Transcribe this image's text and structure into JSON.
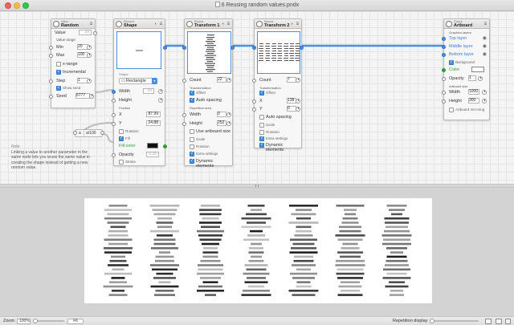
{
  "window": {
    "title": "6 Reusing random values.pndx"
  },
  "colors": {
    "accent": "#4a90e2",
    "wire": "#4a90e2",
    "fill_color": "#111111"
  },
  "random_node": {
    "category": "Value",
    "name": "Random",
    "value_label": "Value",
    "value": "20",
    "range_label": "Value range",
    "min_label": "Min",
    "min": "20",
    "max_label": "Max",
    "max": "100",
    "xrange_label": "x-range",
    "incremental_label": "Incremental",
    "step_label": "Step",
    "step": "1",
    "show_seed_label": "Show seed",
    "seed_label": "Seed",
    "seed": "6777"
  },
  "shape_node": {
    "category": "Element",
    "name": "Shape",
    "shape_section": "Shape",
    "shape_value": "Rectangle",
    "width_label": "Width",
    "width": "20",
    "height_label": "Height",
    "position_label": "Position",
    "x_label": "X",
    "x": "87.99",
    "y_label": "Y",
    "y": "24.88",
    "rotation_label": "Rotation",
    "fill_label": "Fill",
    "fill_color_label": "Fill color",
    "opacity_label": "Opacity",
    "opacity": "0.35",
    "stroke_label": "Stroke"
  },
  "expr_node": {
    "label": "a",
    "value": "a/100"
  },
  "transform1": {
    "category": "Repeat",
    "name": "Transform 1",
    "count_label": "Count",
    "count": "22",
    "transformation_label": "Transformation",
    "offset_label": "Offset",
    "auto_spacing_label": "Auto spacing",
    "repetition_area_label": "Repetition area",
    "width_label": "Width",
    "width": "0",
    "height_label": "Height",
    "height": "252",
    "use_artboard_label": "Use artboard size",
    "scale_label": "Scale",
    "rotation_label": "Rotation",
    "extra_settings_label": "Extra settings",
    "dynamic_label": "Dynamic elements"
  },
  "transform2": {
    "category": "Repeat",
    "name": "Transform 2",
    "count_label": "Count",
    "count": "7",
    "transformation_label": "Transformation",
    "offset_label": "Offset",
    "x_label": "X",
    "x": "138",
    "y_label": "Y",
    "y": "0",
    "auto_spacing_label": "Auto spacing",
    "scale_label": "Scale",
    "rotation_label": "Rotation",
    "extra_settings_label": "Extra settings",
    "dynamic_label": "Dynamic elements"
  },
  "artboard": {
    "category": "Output",
    "name": "Artboard",
    "graphics_layers_label": "Graphics layers",
    "top_layer": "Top layer",
    "middle_layer": "Middle layer",
    "bottom_layer": "Bottom layer",
    "background_label": "Background",
    "color_label": "Color",
    "opacity_label": "Opacity",
    "opacity": "1",
    "size_label": "Artboard size",
    "width_label": "Width",
    "width": "1000",
    "height_label": "Height",
    "height": "300",
    "mirroring_label": "Artboard mirroring"
  },
  "note": {
    "title": "Note",
    "text": "Linking a value to another parameter in the same node lets you reuse the same value in creating the shape instead of getting a new random value."
  },
  "statusbar": {
    "zoom_label": "Zoom",
    "zoom": "100%",
    "fit_label": "Fit",
    "repetition_label": "Repetition display"
  }
}
